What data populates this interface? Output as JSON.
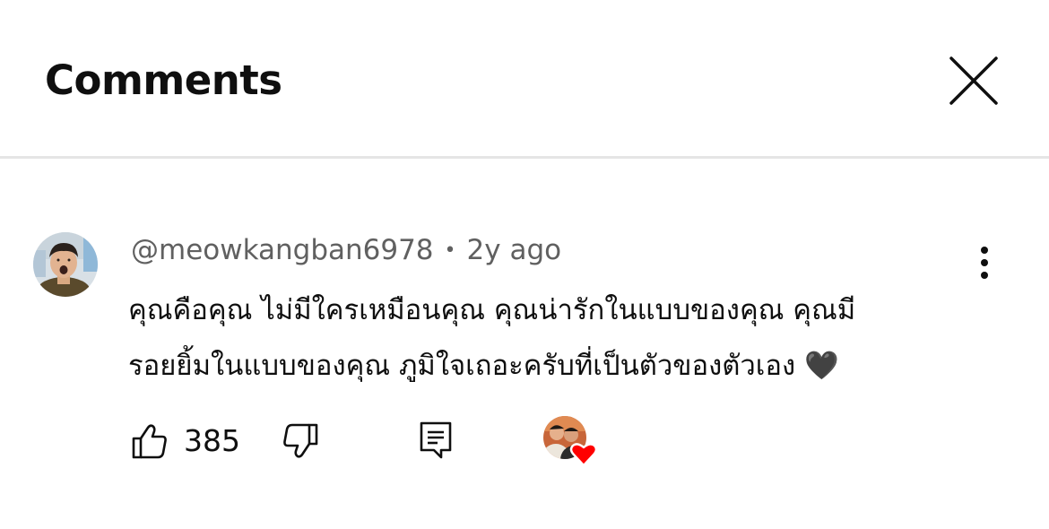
{
  "header": {
    "title": "Comments",
    "close_icon": "close-icon"
  },
  "comment": {
    "author": "@meowkangban6978",
    "separator": "•",
    "time": "2y ago",
    "text_line_1": "คุณคือคุณ ไม่มีใครเหมือนคุณ คุณน่ารักในแบบของคุณ คุณมี",
    "text_line_2": "รอยยิ้มในแบบของคุณ ภูมิใจเถอะครับที่เป็นตัวของตัวเอง",
    "heart_emoji": "🖤",
    "like_count": "385",
    "icons": {
      "avatar": "avatar-image",
      "more": "more-vertical-icon",
      "like": "thumbs-up-icon",
      "dislike": "thumbs-down-icon",
      "reply": "reply-icon",
      "creator_heart": "creator-heart-icon"
    },
    "colors": {
      "heart_red": "#ff0000",
      "text_primary": "#0f0f0f",
      "text_secondary": "#606060"
    }
  }
}
